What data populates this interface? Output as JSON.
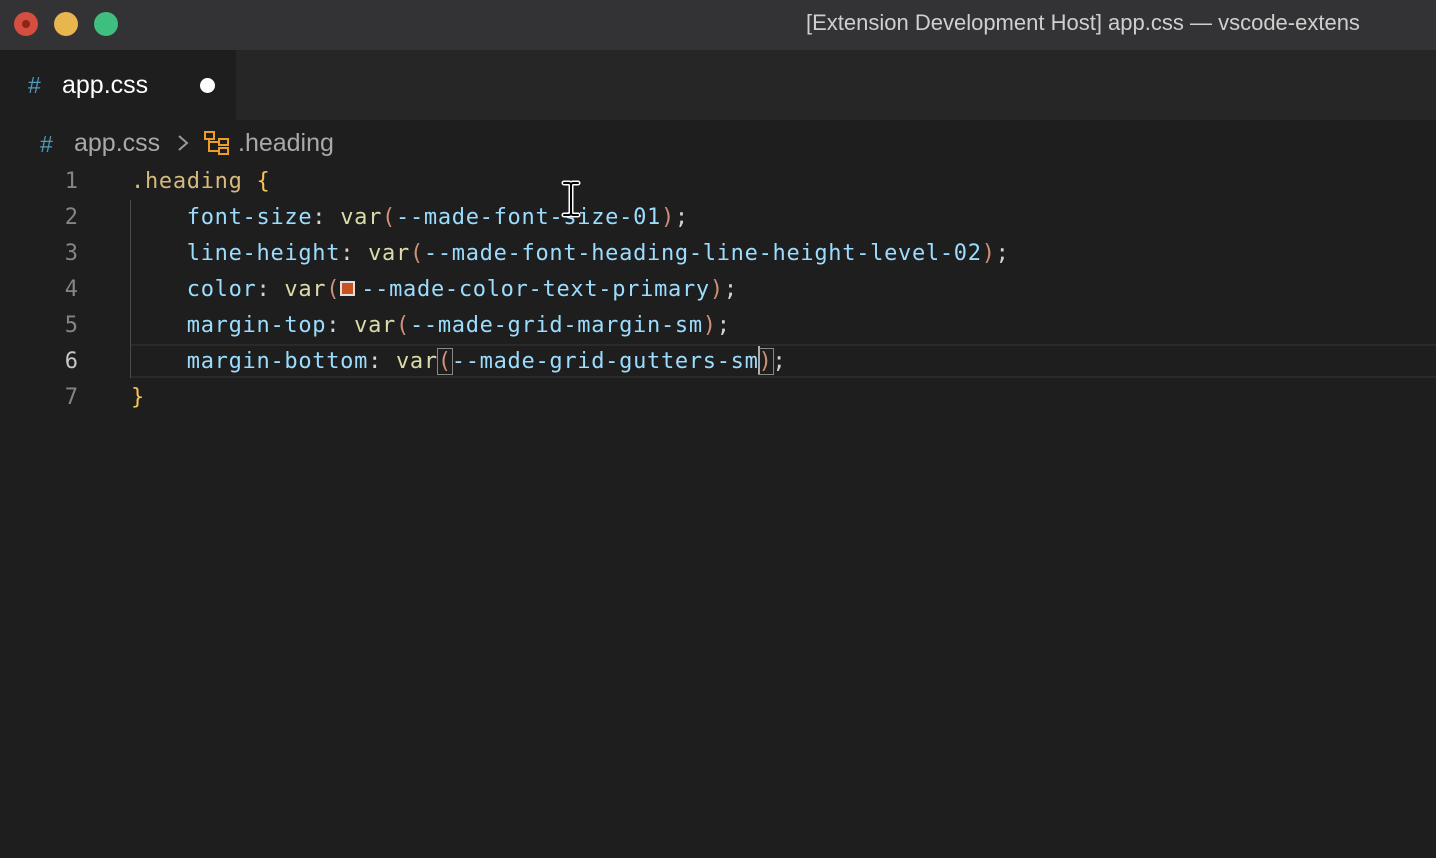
{
  "window": {
    "title": "[Extension Development Host] app.css — vscode-extens"
  },
  "tab": {
    "icon": "css-hash-icon",
    "hash": "#",
    "label": "app.css",
    "dirty_indicator": "unsaved-dot"
  },
  "breadcrumb": {
    "hash": "#",
    "file": "app.css",
    "separator_icon": "chevron-right-icon",
    "symbol_icon": "css-selector-icon",
    "symbol": ".heading"
  },
  "editor": {
    "active_line": 6,
    "lines": [
      {
        "number": "1",
        "selector": ".heading",
        "brace": "{"
      },
      {
        "number": "2",
        "property": "font-size",
        "colon": ":",
        "fn": "var",
        "open": "(",
        "value": "--made-font-size-01",
        "close": ")",
        "semi": ";"
      },
      {
        "number": "3",
        "property": "line-height",
        "colon": ":",
        "fn": "var",
        "open": "(",
        "value": "--made-font-heading-line-height-level-02",
        "close": ")",
        "semi": ";"
      },
      {
        "number": "4",
        "property": "color",
        "colon": ":",
        "fn": "var",
        "open": "(",
        "value": "--made-color-text-primary",
        "close": ")",
        "semi": ";",
        "swatch_color": "#c8531f"
      },
      {
        "number": "5",
        "property": "margin-top",
        "colon": ":",
        "fn": "var",
        "open": "(",
        "value": "--made-grid-margin-sm",
        "close": ")",
        "semi": ";"
      },
      {
        "number": "6",
        "property": "margin-bottom",
        "colon": ":",
        "fn": "var",
        "open": "(",
        "value": "--made-grid-gutters-sm",
        "close": ")",
        "semi": ";"
      },
      {
        "number": "7",
        "brace": "}"
      }
    ]
  },
  "colors": {
    "selector": "#d7ba7d",
    "property": "#9cdcfe",
    "function": "#dcdcaa",
    "brace": "#f8c555",
    "paren": "#ce9178",
    "css_icon": "#519aba"
  }
}
